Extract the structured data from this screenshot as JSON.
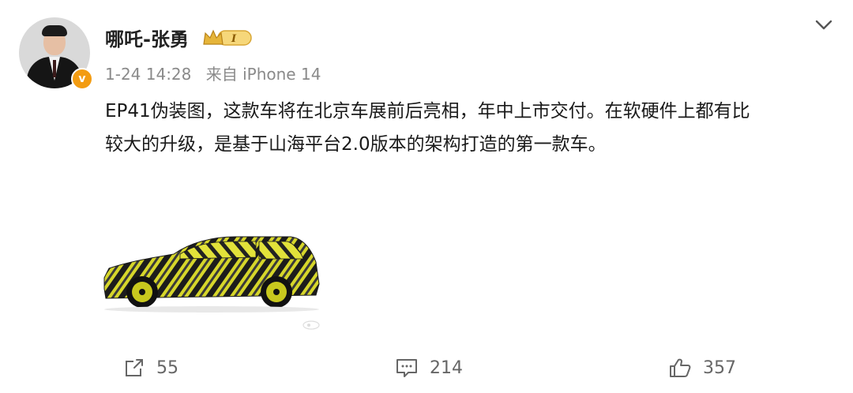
{
  "post": {
    "author": {
      "name": "哪吒-张勇",
      "verified_icon": "v-verified-icon",
      "member_badge_text": "I"
    },
    "meta": {
      "time": "1-24 14:28",
      "source": "来自 iPhone 14"
    },
    "content": {
      "line1": "EP41伪装图，这款车将在北京车展前后亮相，年中上市交付。在软硬件上都有比",
      "line2": "较大的升级，是基于山海平台2.0版本的架构打造的第一款车。"
    },
    "image": {
      "description_icon": "camouflaged-car-image"
    },
    "actions": {
      "share_count": "55",
      "comment_count": "214",
      "like_count": "357"
    },
    "colors": {
      "verified_badge": "#f39c12",
      "camo_yellow": "#d6d62a",
      "text_primary": "#1a1a1a",
      "text_secondary": "#8a8a8a"
    }
  }
}
